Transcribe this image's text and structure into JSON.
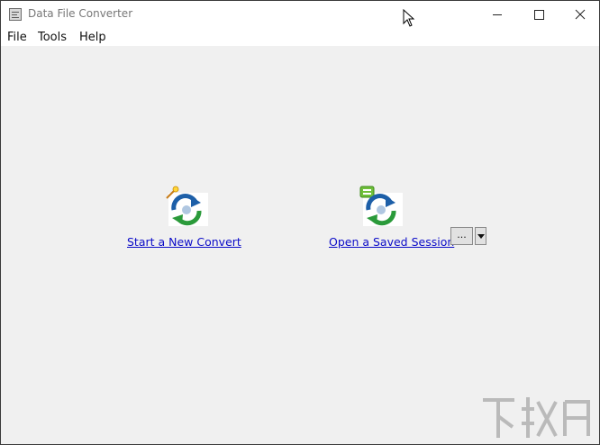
{
  "window": {
    "title": "Data File Converter",
    "controls": [
      "minimize",
      "maximize",
      "close"
    ]
  },
  "menu": {
    "items": [
      {
        "label": "File"
      },
      {
        "label": "Tools"
      },
      {
        "label": "Help"
      }
    ]
  },
  "actions": {
    "new_convert": {
      "label": "Start a New Convert",
      "icon": "new-convert-icon"
    },
    "open_session": {
      "label": "Open a Saved Session",
      "icon": "saved-session-icon"
    },
    "browse_label": "..."
  },
  "colors": {
    "link": "#0b0bc8",
    "icon_blue": "#1d5fa8",
    "icon_green": "#2a9a3a",
    "title_text": "#777777"
  }
}
